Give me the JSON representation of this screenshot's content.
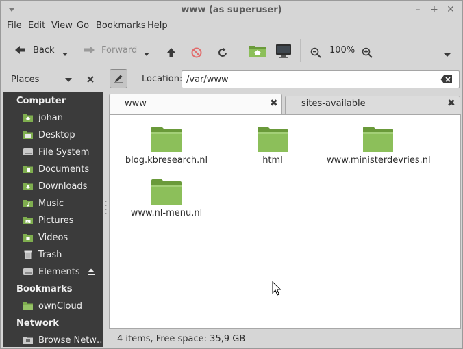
{
  "window": {
    "title": "www (as superuser)"
  },
  "menubar": [
    "File",
    "Edit",
    "View",
    "Go",
    "Bookmarks",
    "Help"
  ],
  "toolbar": {
    "back_label": "Back",
    "forward_label": "Forward",
    "zoom_level": "100%"
  },
  "places_selector": "Places",
  "location": {
    "label": "Location:",
    "value": "/var/www"
  },
  "sidebar": {
    "computer_heading": "Computer",
    "computer_items": [
      {
        "label": "johan",
        "icon": "home-folder-icon"
      },
      {
        "label": "Desktop",
        "icon": "desktop-icon"
      },
      {
        "label": "File System",
        "icon": "drive-icon"
      },
      {
        "label": "Documents",
        "icon": "documents-folder-icon"
      },
      {
        "label": "Downloads",
        "icon": "downloads-folder-icon"
      },
      {
        "label": "Music",
        "icon": "music-folder-icon"
      },
      {
        "label": "Pictures",
        "icon": "pictures-folder-icon"
      },
      {
        "label": "Videos",
        "icon": "videos-folder-icon"
      },
      {
        "label": "Trash",
        "icon": "trash-icon"
      },
      {
        "label": "Elements",
        "icon": "drive-icon"
      }
    ],
    "bookmarks_heading": "Bookmarks",
    "bookmark_items": [
      {
        "label": "ownCloud",
        "icon": "folder-icon"
      }
    ],
    "network_heading": "Network",
    "network_items": [
      {
        "label": "Browse Netw…",
        "icon": "network-icon"
      }
    ]
  },
  "tabs": [
    {
      "label": "www",
      "active": true
    },
    {
      "label": "sites-available",
      "active": false
    }
  ],
  "files": [
    {
      "name": "blog.kbresearch.nl"
    },
    {
      "name": "html"
    },
    {
      "name": "www.ministerdevries.nl"
    },
    {
      "name": "www.nl-menu.nl"
    }
  ],
  "status": "4 items, Free space: 35,9 GB",
  "colors": {
    "sidebar_bg": "#3b3b3b",
    "folder_green": "#7fae4f",
    "accent_green": "#6a9a3a"
  }
}
